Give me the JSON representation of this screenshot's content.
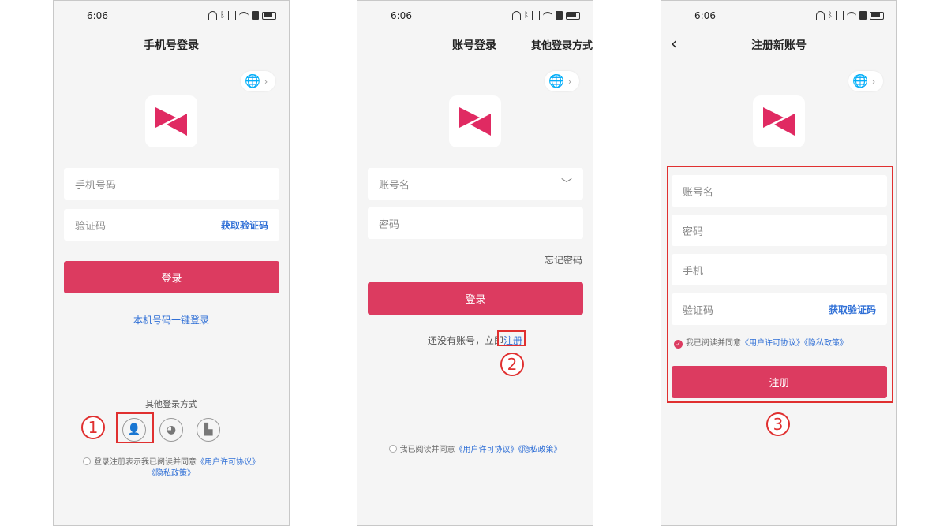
{
  "colors": {
    "primary": "#dc3b60",
    "link": "#2f6fd6",
    "highlight": "#e03030"
  },
  "status_time": "6:06",
  "screen1": {
    "title": "手机号登录",
    "phone_placeholder": "手机号码",
    "code_placeholder": "验证码",
    "get_code": "获取验证码",
    "login_button": "登录",
    "one_click": "本机号码一键登录",
    "other_methods": "其他登录方式",
    "agreement_prefix": "登录注册表示我已阅读并同意",
    "user_agreement": "《用户许可协议》",
    "privacy_policy": "《隐私政策》",
    "step": "1",
    "icons": [
      "account-icon",
      "wechat-icon",
      "building-icon"
    ]
  },
  "screen2": {
    "title": "账号登录",
    "alt_login": "其他登录方式",
    "account_placeholder": "账号名",
    "password_placeholder": "密码",
    "forgot_password": "忘记密码",
    "login_button": "登录",
    "no_account_prefix": "还没有账号，立即",
    "register_link": "注册",
    "step": "2",
    "agreement_prefix": "我已阅读并同意",
    "user_agreement": "《用户许可协议》",
    "privacy_policy": "《隐私政策》"
  },
  "screen3": {
    "title": "注册新账号",
    "account_placeholder": "账号名",
    "password_placeholder": "密码",
    "phone_placeholder": "手机",
    "code_placeholder": "验证码",
    "get_code": "获取验证码",
    "agreement_prefix": "我已阅读并同意",
    "user_agreement": "《用户许可协议》",
    "privacy_policy": "《隐私政策》",
    "register_button": "注册",
    "step": "3"
  }
}
